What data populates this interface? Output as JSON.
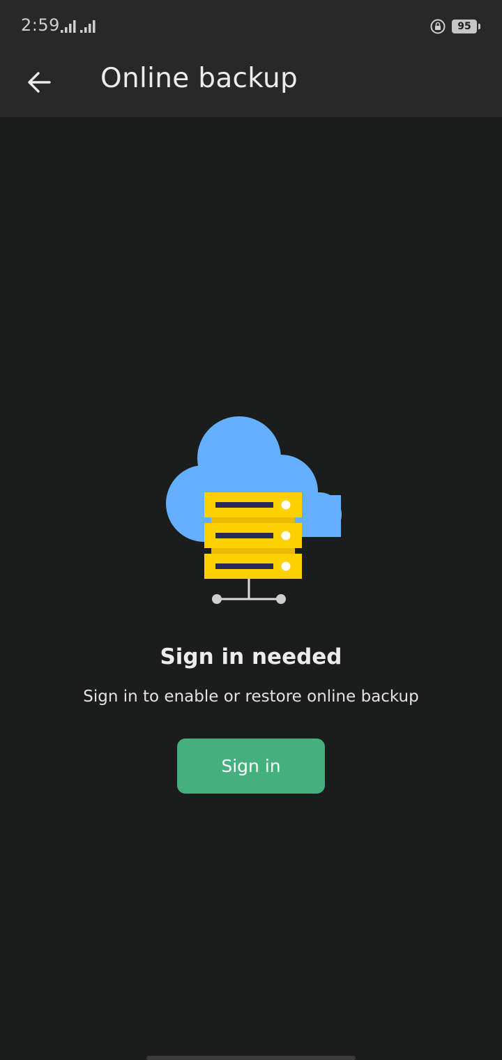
{
  "status_bar": {
    "time": "2:59",
    "battery": "95",
    "icons": [
      "signal-icon",
      "signal-icon",
      "rotation-lock-icon",
      "battery-icon"
    ]
  },
  "app_bar": {
    "title": "Online backup",
    "back_icon": "arrow-left-icon"
  },
  "empty_state": {
    "illustration": "cloud-server-icon",
    "title": "Sign in needed",
    "subtitle": "Sign in to enable or restore online backup",
    "button_label": "Sign in"
  },
  "colors": {
    "app_bar_bg": "#282828",
    "page_bg": "#1b1c1c",
    "accent_button": "#44b07d",
    "cloud": "#64b0fe",
    "server": "#fdd000",
    "server_slot": "#262a55"
  }
}
